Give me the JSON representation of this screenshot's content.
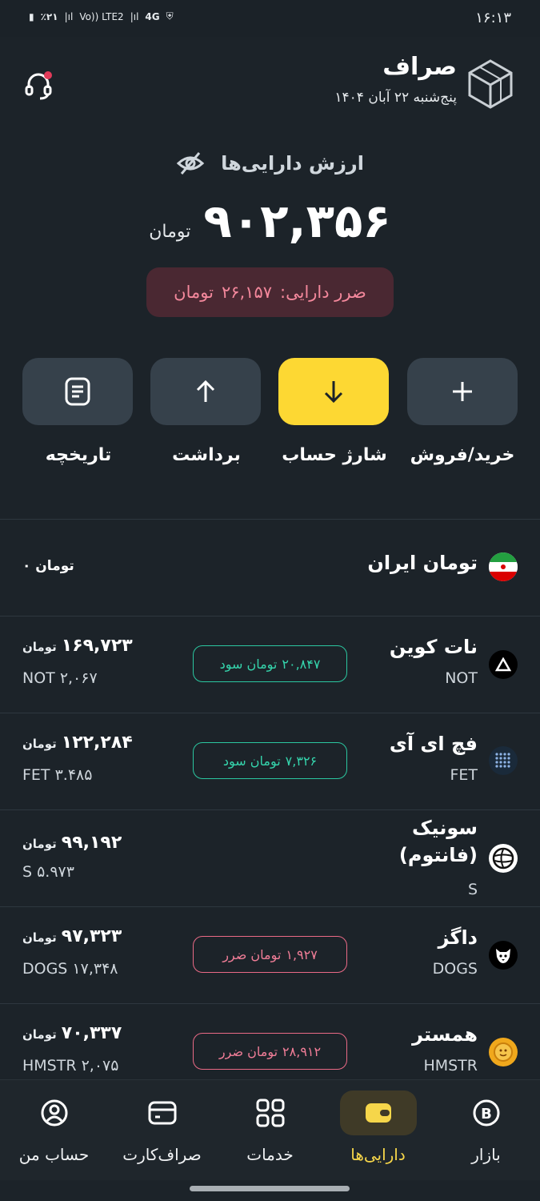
{
  "status_bar": {
    "time": "۱۶:۱۳",
    "battery": "٪۲۱",
    "volte": "Vo)) LTE2",
    "network": "4G"
  },
  "header": {
    "title": "صراف",
    "date": "پنج‌شنبه ۲۲ آبان ۱۴۰۴"
  },
  "portfolio": {
    "label": "ارزش دارایی‌ها",
    "value": "۹۰۲,۳۵۶",
    "unit": "تومان",
    "loss_label": "ضرر دارایی:",
    "loss_value": "۲۶,۱۵۷",
    "loss_unit": "تومان"
  },
  "actions": [
    {
      "label": "خرید/فروش",
      "icon": "plus-icon"
    },
    {
      "label": "شارژ حساب",
      "icon": "arrow-down-icon"
    },
    {
      "label": "برداشت",
      "icon": "arrow-up-icon"
    },
    {
      "label": "تاریخچه",
      "icon": "history-icon"
    }
  ],
  "rial": {
    "name": "تومان ایران",
    "amount": "۰ تومان"
  },
  "assets": [
    {
      "name": "نات کوین",
      "symbol": "NOT",
      "value": "۱۶۹,۷۲۳",
      "unit": "تومان",
      "qty": "NOT ۲,۰۶۷",
      "pnl_value": "۲۰,۸۴۷",
      "pnl_label": "تومان سود",
      "pnl_type": "profit"
    },
    {
      "name": "فچ ای آی",
      "symbol": "FET",
      "value": "۱۲۲,۲۸۴",
      "unit": "تومان",
      "qty": "FET ۳.۴۸۵",
      "pnl_value": "۷,۳۲۶",
      "pnl_label": "تومان سود",
      "pnl_type": "profit"
    },
    {
      "name_line1": "سونیک",
      "name_line2": "(فانتوم)",
      "symbol": "S",
      "value": "۹۹,۱۹۲",
      "unit": "تومان",
      "qty": "S ۵.۹۷۳"
    },
    {
      "name": "داگز",
      "symbol": "DOGS",
      "value": "۹۷,۳۲۳",
      "unit": "تومان",
      "qty": "DOGS ۱۷,۳۴۸",
      "pnl_value": "۱,۹۲۷",
      "pnl_label": "تومان ضرر",
      "pnl_type": "loss"
    },
    {
      "name": "همستر",
      "symbol": "HMSTR",
      "value": "۷۰,۳۳۷",
      "unit": "تومان",
      "qty": "HMSTR ۲,۰۷۵",
      "pnl_value": "۲۸,۹۱۲",
      "pnl_label": "تومان ضرر",
      "pnl_type": "loss"
    }
  ],
  "nav": [
    {
      "label": "بازار",
      "icon": "bitcoin-icon"
    },
    {
      "label": "دارایی‌ها",
      "icon": "wallet-icon",
      "active": true
    },
    {
      "label": "خدمات",
      "icon": "grid-icon"
    },
    {
      "label": "صراف‌کارت",
      "icon": "card-icon"
    },
    {
      "label": "حساب من",
      "icon": "user-icon"
    }
  ],
  "colors": {
    "background": "#1c2329",
    "accent": "#fdd833",
    "profit": "#35d4ac",
    "loss": "#f07d97"
  }
}
